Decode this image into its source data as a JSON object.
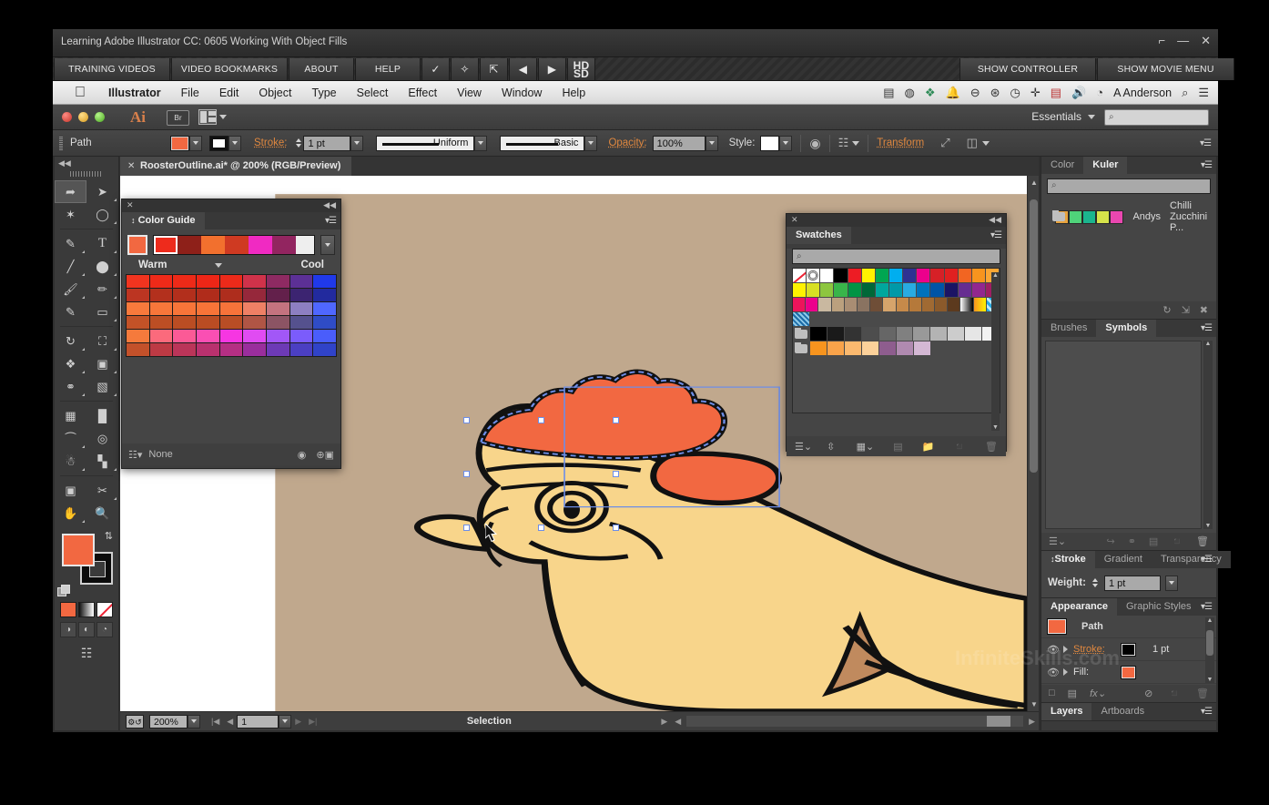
{
  "window": {
    "title": "Learning Adobe Illustrator CC: 0605 Working With Object Fills",
    "restore_icon": "restore-icon",
    "minimize_icon": "—",
    "close_icon": "✕"
  },
  "lynda_tabs": [
    {
      "label": "TRAINING VIDEOS",
      "name": "training-videos"
    },
    {
      "label": "VIDEO BOOKMARKS",
      "name": "video-bookmarks"
    },
    {
      "label": "ABOUT",
      "name": "about"
    },
    {
      "label": "HELP",
      "name": "help"
    },
    {
      "label": "✓",
      "name": "check"
    },
    {
      "label": "✧",
      "name": "bookmark"
    },
    {
      "label": "⇱",
      "name": "popout"
    },
    {
      "label": "◀",
      "name": "previous"
    },
    {
      "label": "▶",
      "name": "next"
    },
    {
      "label": "HD SD",
      "name": "quality"
    }
  ],
  "lynda_right": [
    {
      "label": "SHOW CONTROLLER",
      "name": "show-controller"
    },
    {
      "label": "SHOW MOVIE MENU",
      "name": "show-movie-menu"
    }
  ],
  "mac": {
    "apple": "",
    "menus": [
      "Illustrator",
      "File",
      "Edit",
      "Object",
      "Type",
      "Select",
      "Effect",
      "View",
      "Window",
      "Help"
    ],
    "status_icons": [
      "film-icon",
      "clock-icon",
      "dropbox-icon",
      "bell-icon",
      "message-icon",
      "accessibility-icon",
      "timemachine-icon",
      "move-icon",
      "flag-icon",
      "volume-icon",
      "location-icon"
    ],
    "user": "A Anderson",
    "search_icon": "search-icon",
    "list_icon": "notification-center-icon"
  },
  "appbar": {
    "logo": "Ai",
    "bridge": "Br",
    "arrange": "arrange-documents",
    "workspace": "Essentials",
    "search_placeholder": ""
  },
  "control_bar": {
    "object_label": "Path",
    "fill_color": "#f26841",
    "stroke_label": "Stroke:",
    "stroke_weight": "1 pt",
    "profile": "Uniform",
    "brush": "Basic",
    "opacity_label": "Opacity:",
    "opacity_value": "100%",
    "style_label": "Style:",
    "transform_label": "Transform",
    "isolate_icon": "isolate-icon",
    "align_icon": "align-icon",
    "panel_menu_icon": "panel-menu-icon"
  },
  "tools": {
    "collapse_icon": "◀◀",
    "items": [
      "selection-tool",
      "direct-selection-tool",
      "magic-wand-tool",
      "lasso-tool",
      "pen-tool",
      "type-tool",
      "line-segment-tool",
      "ellipse-tool",
      "paintbrush-tool",
      "pencil-tool",
      "blob-brush-tool",
      "eraser-tool",
      "rotate-tool",
      "scale-tool",
      "width-tool",
      "free-transform-tool",
      "shape-builder-tool",
      "perspective-grid-tool",
      "mesh-tool",
      "gradient-tool",
      "eyedropper-tool",
      "blend-tool",
      "symbol-sprayer-tool",
      "column-graph-tool",
      "artboard-tool",
      "slice-tool",
      "hand-tool",
      "zoom-tool"
    ],
    "fill_color": "#f26841",
    "stroke_color": "#0b0b0b",
    "swap_icon": "swap-fill-stroke-icon",
    "default_icon": "default-fill-stroke-icon",
    "color_modes": [
      "color-mode",
      "gradient-mode",
      "none-mode"
    ],
    "draw_modes": [
      "draw-normal",
      "draw-behind",
      "draw-inside"
    ],
    "screen_mode": "change-screen-mode-icon"
  },
  "document": {
    "tab_title": "RoosterOutline.ai* @ 200% (RGB/Preview)",
    "close_icon": "✕"
  },
  "status_bar": {
    "zoom": "200%",
    "artboard": "1",
    "status": "Selection",
    "nav_first": "|◀",
    "nav_prev": "◀",
    "nav_next": "▶",
    "nav_last": "▶|"
  },
  "color_guide": {
    "title": "Color Guide",
    "warm_label": "Warm",
    "cool_label": "Cool",
    "harmony_colors": [
      "#ee2b1c",
      "#8e2019",
      "#f2702e",
      "#cf3a22",
      "#f02ac2",
      "#922560"
    ],
    "base_color": "#f26841",
    "footer_label": "None",
    "grid": [
      [
        "#f1341f",
        "#ef2a19",
        "#ee2a18",
        "#ee2617",
        "#ec2a1a",
        "#d0324a",
        "#8e2a62",
        "#5c3096",
        "#2039ea"
      ],
      [
        "#bc3522",
        "#b3301d",
        "#b22f1c",
        "#b02c1b",
        "#ae2d1d",
        "#96283b",
        "#63204b",
        "#3c2471",
        "#222a9e"
      ],
      [
        "#f8793c",
        "#f8763a",
        "#f87539",
        "#f87438",
        "#f7733a",
        "#ef8065",
        "#c4737f",
        "#8d7fc1",
        "#4f67ff"
      ],
      [
        "#c35227",
        "#bc4e24",
        "#bb4d23",
        "#ba4c23",
        "#b94d25",
        "#b05545",
        "#8c5464",
        "#55518e",
        "#2f4cc6"
      ],
      [
        "#f57a3c",
        "#fb6a7c",
        "#fb5a96",
        "#fa4fb3",
        "#f636e2",
        "#e04bf2",
        "#a257f7",
        "#7b5cfb",
        "#4a5dfb"
      ],
      [
        "#c3512a",
        "#bd3a44",
        "#bb3559",
        "#b9316e",
        "#b52f84",
        "#9a2e9d",
        "#6d3ab6",
        "#4b3fc2",
        "#3043c8"
      ]
    ]
  },
  "swatches": {
    "title": "Swatches",
    "search_placeholder": "",
    "rows": [
      [
        "none",
        "registration",
        "#ffffff",
        "#000000",
        "#ed1c24",
        "#fff200",
        "#00a651",
        "#00aeef",
        "#2e3192",
        "#ec008c",
        "#ed1c24",
        "#e02020",
        "#f26522",
        "#f7941e",
        "#faa634"
      ],
      [
        "#fff200",
        "#d7df23",
        "#8dc63f",
        "#39b54a",
        "#009444",
        "#006838",
        "#00a79d",
        "#0099a8",
        "#29abe2",
        "#0072bc",
        "#0054a6",
        "#1b1464",
        "#662d91",
        "#92278f",
        "#9e1f63"
      ],
      [
        "#ed145b",
        "#ec008c",
        "#c9b8a0",
        "#bba07e",
        "#a98d73",
        "#6f4e37",
        "#d6a46b",
        "#c68a4a",
        "#b5793a",
        "#a06a33",
        "#8b5a2b",
        "#5c3a1e",
        "#gradient",
        "#orange-grad",
        "#pattern-blue"
      ],
      [
        "#pattern-confetti"
      ]
    ],
    "gray_row": [
      "#000000",
      "#1a1a1a",
      "#333333",
      "#4d4d4d",
      "#666666",
      "#808080",
      "#999999",
      "#b3b3b3",
      "#cccccc",
      "#e6e6e6",
      "#f2f2f2"
    ],
    "tan_row": [
      "#f7941e",
      "#f9a34a",
      "#fbb96f",
      "#fcd19a",
      "#8e5d8e",
      "#b08ab0",
      "#d4b8d4"
    ],
    "footer_icons": [
      "swatch-libraries-icon",
      "kuler-icon",
      "show-swatch-kinds-icon",
      "swatch-options-icon",
      "new-color-group-icon",
      "new-swatch-icon",
      "delete-swatch-icon"
    ]
  },
  "dock": {
    "color_kuler": {
      "tabs": [
        "Color",
        "Kuler"
      ],
      "active": "Kuler",
      "search_placeholder": "",
      "item_colors": [
        "#e8a33d",
        "#4fd37a",
        "#1bb58e",
        "#d6e34a",
        "#ea47b0"
      ],
      "item_author": "Andys",
      "item_name": "Chilli Zucchini P...",
      "footer_icons": [
        "refresh-icon",
        "add-to-swatches-icon",
        "edit-in-kuler-icon"
      ]
    },
    "brushes_symbols": {
      "tabs": [
        "Brushes",
        "Symbols"
      ],
      "active": "Symbols",
      "footer_icons": [
        "symbol-libraries-icon",
        "place-symbol-icon",
        "break-link-icon",
        "symbol-options-icon",
        "new-symbol-icon",
        "delete-symbol-icon"
      ]
    },
    "stroke_panel": {
      "tabs": [
        "Stroke",
        "Gradient",
        "Transparency"
      ],
      "active": "Stroke",
      "weight_label": "Weight:",
      "weight_value": "1 pt"
    },
    "appearance": {
      "tabs": [
        "Appearance",
        "Graphic Styles"
      ],
      "active": "Appearance",
      "object_name": "Path",
      "object_color": "#f26841",
      "rows": [
        {
          "label": "Stroke:",
          "color": "#000000",
          "value": "1 pt",
          "link": true
        },
        {
          "label": "Fill:",
          "color": "#f26841",
          "value": "",
          "link": false
        }
      ],
      "footer_icons": [
        "add-new-stroke-icon",
        "add-new-fill-icon",
        "fx-icon",
        "clear-appearance-icon",
        "duplicate-item-icon",
        "delete-item-icon"
      ]
    },
    "layers": {
      "tabs": [
        "Layers",
        "Artboards"
      ],
      "active": "Layers"
    }
  },
  "artwork": {
    "background": "#c0a88d",
    "body_fill": "#f8d58b",
    "comb_fill": "#f26841",
    "wattle_fill": "#c08a5e",
    "outline": "#111111",
    "selection_color": "#6d8ee8"
  },
  "watermark": "InfiniteSkills.com"
}
